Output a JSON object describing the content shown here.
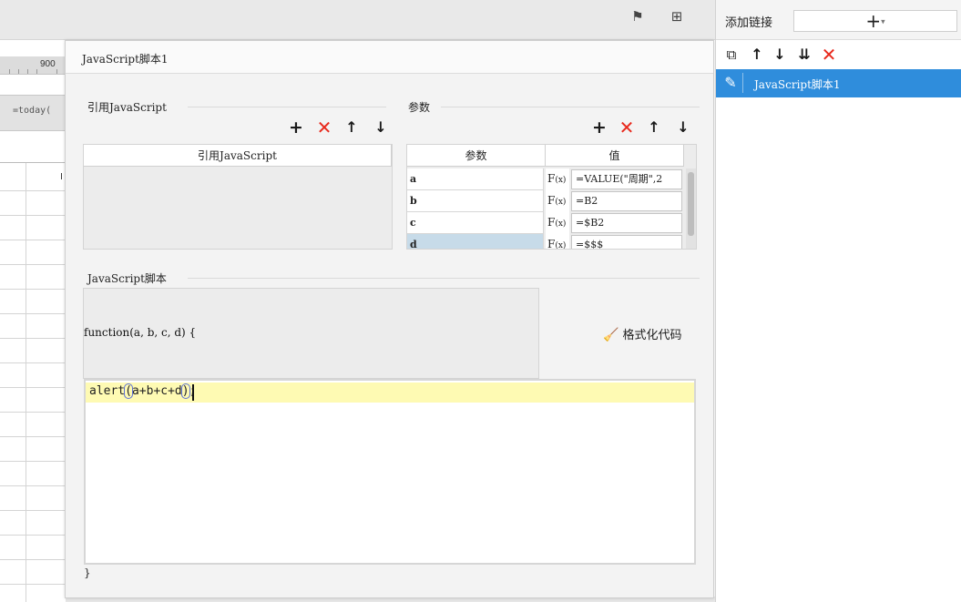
{
  "background": {
    "ruler_number": "900",
    "formula_text": "=today(",
    "grid_col_char": "I",
    "topbar_icons": [
      "flag-icon",
      "layout-icon"
    ]
  },
  "dialog": {
    "title": "JavaScript脚本1",
    "ref_js_section": {
      "label": "引用JavaScript",
      "column_header": "引用JavaScript",
      "toolbar": [
        "+",
        "✕",
        "↑",
        "↓"
      ]
    },
    "params_section": {
      "label": "参数",
      "column_headers": [
        "参数",
        "值"
      ],
      "toolbar": [
        "+",
        "✕",
        "↑",
        "↓"
      ],
      "rows": [
        {
          "name": "a",
          "fx": "F",
          "fx_sub": "(x)",
          "value": "=VALUE(\"周期\",2"
        },
        {
          "name": "b",
          "fx": "F",
          "fx_sub": "(x)",
          "value": "=B2"
        },
        {
          "name": "c",
          "fx": "F",
          "fx_sub": "(x)",
          "value": "=$B2"
        },
        {
          "name": "d",
          "fx": "F",
          "fx_sub": "(x)",
          "value": "=$$$"
        }
      ]
    },
    "script_section": {
      "label": "JavaScript脚本",
      "header_text": "function(a, b, c, d) {",
      "format_button": "格式化代码",
      "code_before": "alert",
      "code_paren_open": "(",
      "code_mid": "a+b+c+d",
      "code_paren_close": ")",
      "code_after": ";",
      "footer_text": "}"
    }
  },
  "right_panel": {
    "add_link_label": "添加链接",
    "add_symbol": "+",
    "add_dropdown": "▾",
    "toolbar": [
      "copy-icon",
      "up-arrow-icon",
      "down-arrow-icon",
      "sort-down-icon",
      "delete-icon"
    ],
    "toolbar_glyphs": [
      "⧉",
      "↑",
      "↓",
      "⇊",
      "✕"
    ],
    "items": [
      {
        "label": "JavaScript脚本1",
        "selected": true
      }
    ]
  },
  "colors": {
    "accent_blue": "#2f8ddc",
    "delete_red": "#e8291c",
    "selected_row": "#c7dbe9",
    "highlight_line": "#fefab3"
  }
}
